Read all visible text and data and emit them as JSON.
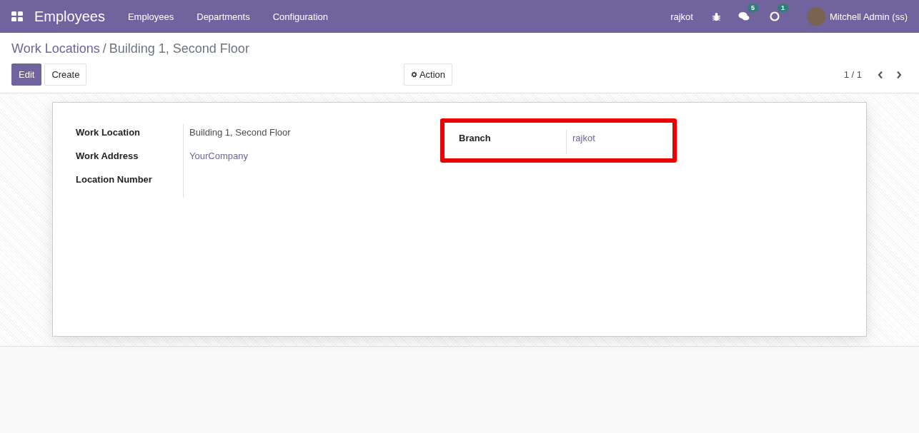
{
  "navbar": {
    "app_title": "Employees",
    "menu": [
      {
        "label": "Employees"
      },
      {
        "label": "Departments"
      },
      {
        "label": "Configuration"
      }
    ],
    "company": "rajkot",
    "messages_count": "5",
    "activities_count": "1",
    "user": "Mitchell Admin (ss)"
  },
  "breadcrumb": {
    "parent": "Work Locations",
    "separator": "/",
    "current": "Building 1, Second Floor"
  },
  "buttons": {
    "edit": "Edit",
    "create": "Create",
    "action": "Action"
  },
  "pager": "1 / 1",
  "form": {
    "left_group": [
      {
        "label": "Work Location",
        "value": "Building 1, Second Floor",
        "kind": "text"
      },
      {
        "label": "Work Address",
        "value": "YourCompany",
        "kind": "link"
      },
      {
        "label": "Location Number"
      }
    ],
    "right_group": {
      "highlighted": true,
      "fields": [
        {
          "label": "Branch",
          "value": "rajkot",
          "kind": "link"
        }
      ]
    }
  }
}
